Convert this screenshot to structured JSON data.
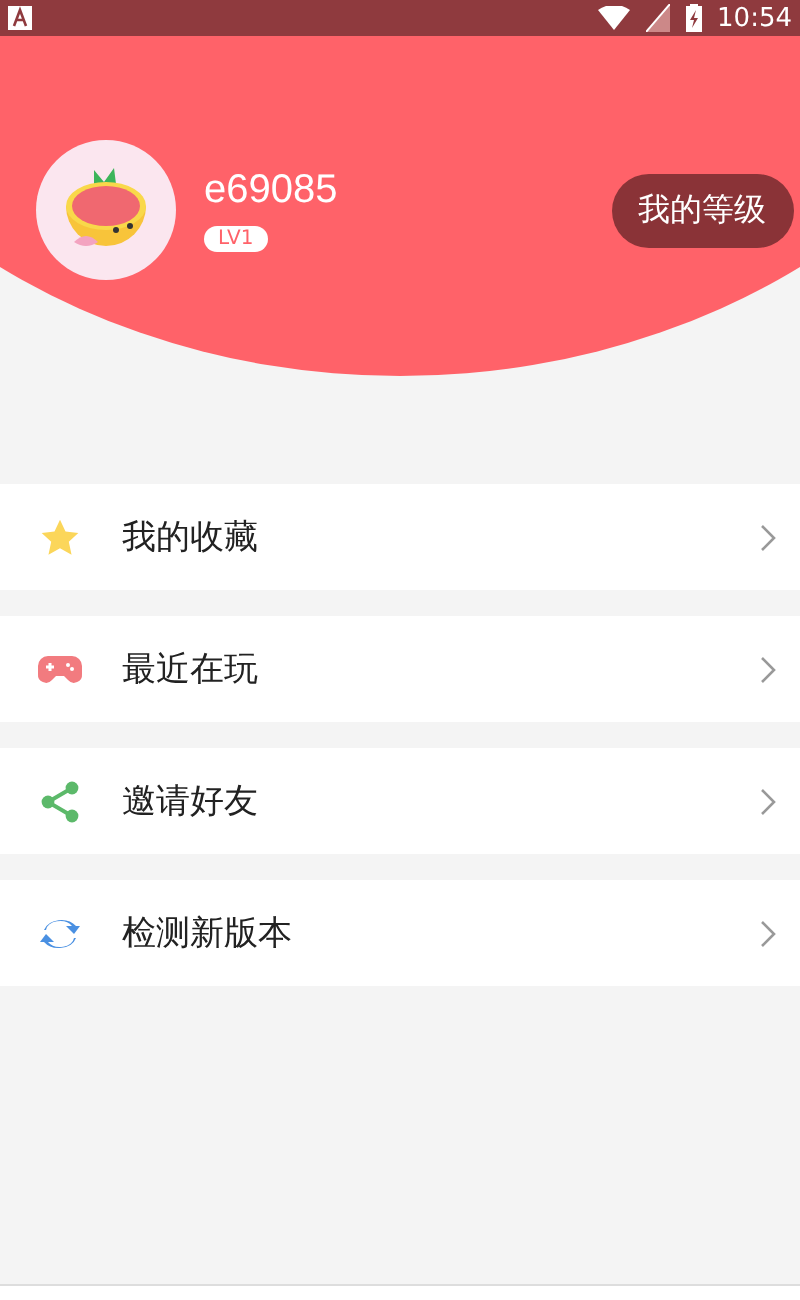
{
  "status_bar": {
    "time": "10:54"
  },
  "profile": {
    "username": "e69085",
    "level_badge": "LV1",
    "level_button": "我的等级"
  },
  "menu": [
    {
      "kind": "star",
      "label": "我的收藏"
    },
    {
      "kind": "gamepad",
      "label": "最近在玩"
    },
    {
      "kind": "share",
      "label": "邀请好友"
    },
    {
      "kind": "refresh",
      "label": "检测新版本"
    }
  ]
}
